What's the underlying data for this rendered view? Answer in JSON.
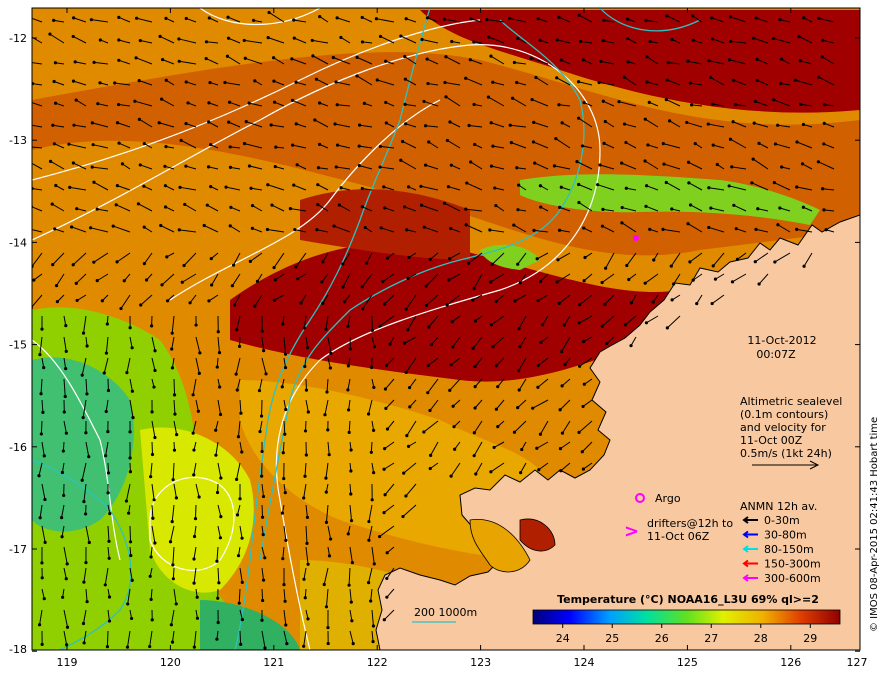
{
  "map": {
    "lon_ticks": [
      "119",
      "120",
      "121",
      "122",
      "123",
      "124",
      "125",
      "126",
      "127"
    ],
    "lat_ticks": [
      "-12",
      "-13",
      "-14",
      "-15",
      "-16",
      "-17",
      "-18"
    ],
    "date": "11-Oct-2012",
    "time": "00:07Z",
    "altimetry_lines": [
      "Altimetric sealevel",
      "(0.1m contours)",
      "and velocity for",
      "11-Oct 00Z",
      "0.5m/s (1kt 24h)"
    ],
    "argo_label": "Argo",
    "drifters_lines": [
      "drifters@12h to",
      "11-Oct 06Z"
    ],
    "anmn_title": "ANMN 12h av.",
    "anmn_items": [
      {
        "label": "0-30m",
        "color": "#000000"
      },
      {
        "label": "30-80m",
        "color": "#0000ff"
      },
      {
        "label": "80-150m",
        "color": "#00e0e0"
      },
      {
        "label": "150-300m",
        "color": "#ff0000"
      },
      {
        "label": "300-600m",
        "color": "#ff00ff"
      }
    ],
    "isobath_label": "200  1000m",
    "colorbar_title": "Temperature (°C) NOAA16_L3U 69% ql>=2",
    "colorbar_ticks": [
      "24",
      "25",
      "26",
      "27",
      "28",
      "29"
    ],
    "credit": "© IMOS 08-Apr-2015 02:41:43 Hobart time",
    "colors": {
      "land": "#f8c9a0",
      "warm": "#cc5a00",
      "hot": "#a80000",
      "mid": "#e89a00",
      "cool": "#8ad000",
      "coolest": "#40c080",
      "contour": "#ffffff",
      "isobath": "#30c0c0"
    }
  }
}
